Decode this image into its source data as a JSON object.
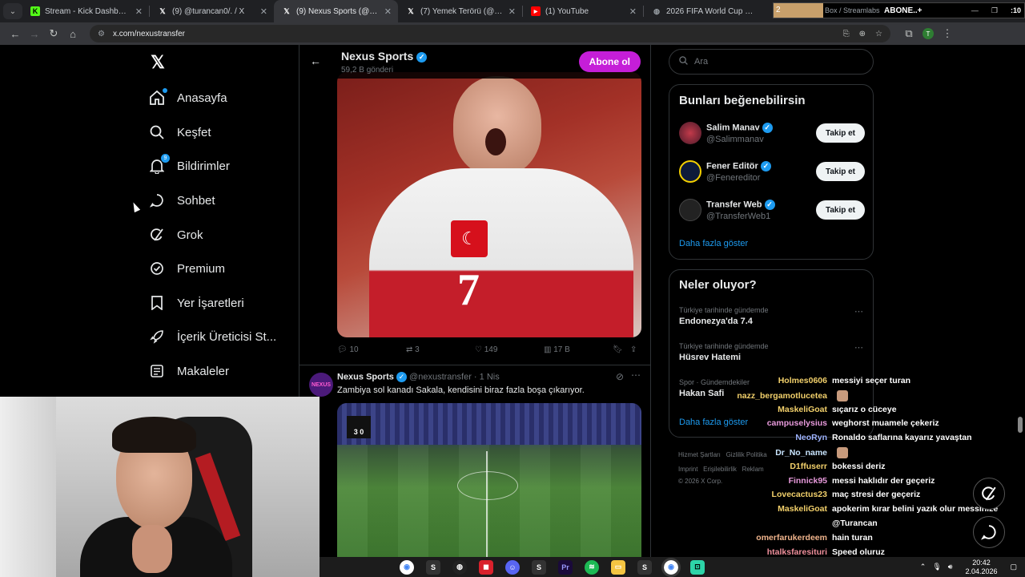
{
  "browser": {
    "tabs": [
      {
        "title": "Stream - Kick Dashboard",
        "favicon": "kick-icon"
      },
      {
        "title": "(9) @turancan0/. / X",
        "favicon": "x-logo-icon"
      },
      {
        "title": "(9) Nexus Sports (@nexustransfer",
        "favicon": "x-logo-icon"
      },
      {
        "title": "(7) Yemek Terörü (@yemekteror",
        "favicon": "x-logo-icon"
      },
      {
        "title": "(1) YouTube",
        "favicon": "youtube-icon"
      },
      {
        "title": "2026 FIFA World Cup Bracket P",
        "favicon": "globe-icon"
      }
    ],
    "url": "x.com/nexustransfer",
    "profile_initial": "T"
  },
  "stream_overlay": {
    "goal_count": "2",
    "label": "Box / Streamlabs",
    "abone_text": "ABONE..+",
    "counter": ":10"
  },
  "sidebar": {
    "items": [
      {
        "label": "Anasayfa",
        "icon": "home-icon"
      },
      {
        "label": "Keşfet",
        "icon": "search-icon"
      },
      {
        "label": "Bildirimler",
        "icon": "bell-icon",
        "badge": "9"
      },
      {
        "label": "Sohbet",
        "icon": "chat-bubble-icon"
      },
      {
        "label": "Grok",
        "icon": "grok-icon"
      },
      {
        "label": "Premium",
        "icon": "verified-badge-icon"
      },
      {
        "label": "Yer İşaretleri",
        "icon": "bookmark-icon"
      },
      {
        "label": "İçerik Üreticisi St...",
        "icon": "rocket-icon"
      },
      {
        "label": "Makaleler",
        "icon": "article-icon"
      }
    ]
  },
  "profile_header": {
    "name": "Nexus Sports",
    "post_count": "59,2 B gönderi",
    "subscribe_label": "Abone ol"
  },
  "post1": {
    "jersey_number": "7",
    "actions": {
      "replies": "10",
      "reposts": "3",
      "likes": "149",
      "views": "17 B"
    }
  },
  "post2": {
    "name": "Nexus Sports",
    "handle": "@nexustransfer",
    "time": "· 1 Nis",
    "text": "Zambiya sol kanadı Sakala, kendisini biraz fazla boşa çıkarıyor.",
    "avatar_text": "NEXUS",
    "score": "3 0"
  },
  "search": {
    "placeholder": "Ara"
  },
  "suggestions": {
    "title": "Bunları beğenebilirsin",
    "follow_label": "Takip et",
    "show_more": "Daha fazla göster",
    "users": [
      {
        "name": "Salim Manav",
        "handle": "@Salimmanav"
      },
      {
        "name": "Fener Editör",
        "handle": "@Fenereditor"
      },
      {
        "name": "Transfer Web",
        "handle": "@TransferWeb1"
      }
    ]
  },
  "trends": {
    "title": "Neler oluyor?",
    "show_more": "Daha fazla göster",
    "items": [
      {
        "context": "Türkiye tarihinde gündemde",
        "title": "Endonezya'da 7.4"
      },
      {
        "context": "Türkiye tarihinde gündemde",
        "title": "Hüsrev Hatemi"
      },
      {
        "context": "Spor · Gündemdekiler",
        "title": "Hakan Safi"
      }
    ]
  },
  "footer": {
    "line1": [
      "Hizmet Şartları",
      "Gizlilik Politika"
    ],
    "line2": [
      "Imprint",
      "Erişilebilirlik",
      "Reklam"
    ],
    "copyright": "© 2026 X Corp."
  },
  "chat": [
    {
      "user": "Holmes0606",
      "msg": "messiyi seçer turan",
      "color": "#f2d06b"
    },
    {
      "user": "nazz_bergamotlucetea",
      "msg": "",
      "color": "#f2d06b"
    },
    {
      "user": "MaskeliGoat",
      "msg": "sıçarız o cüceye",
      "color": "#f2d06b"
    },
    {
      "user": "campuselysius",
      "msg": "weghorst muamele çekeriz",
      "color": "#e89adc"
    },
    {
      "user": "NeoRyn",
      "msg": "Ronaldo saflarına kayarız yavaştan",
      "color": "#9fb4ff"
    },
    {
      "user": "Dr_No_name",
      "msg": "",
      "color": "#c9e5ff"
    },
    {
      "user": "D1ffuserr",
      "msg": "bokessi deriz",
      "color": "#f2d06b"
    },
    {
      "user": "Finnick95",
      "msg": "messi haklıdır der geçeriz",
      "color": "#e89adc"
    },
    {
      "user": "Lovecactus23",
      "msg": "maç stresi der geçeriz",
      "color": "#f2d06b"
    },
    {
      "user": "MaskeliGoat",
      "msg": "apokerim kırar belini yazık olur messinize",
      "color": "#f2d06b"
    },
    {
      "user": "",
      "msg": "@Turancan",
      "color": "#ffffff"
    },
    {
      "user": "omerfarukerdeem",
      "msg": "hain turan",
      "color": "#f0b48c"
    },
    {
      "user": "htalksfaresituri",
      "msg": "Speed oluruz",
      "color": "#f0909c"
    },
    {
      "user": "Ciro101",
      "msg": "olur",
      "color": "#f05a5a"
    }
  ],
  "system_tray": {
    "time": "20:42",
    "date": "2.04.2026"
  }
}
